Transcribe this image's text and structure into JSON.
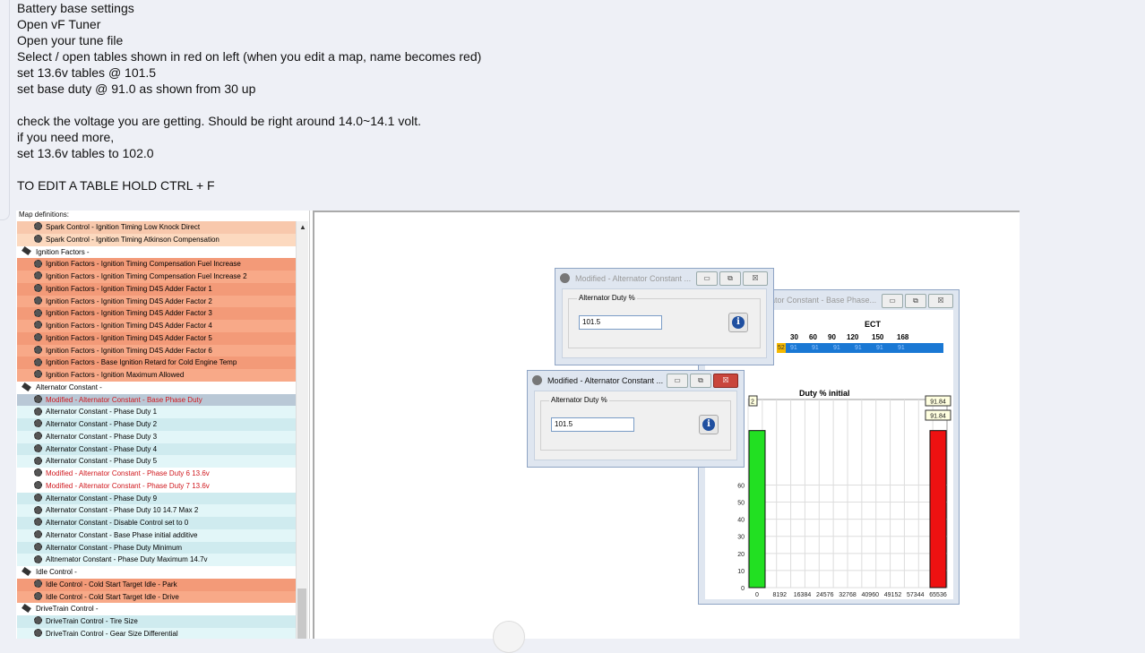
{
  "post": {
    "lines": [
      "Battery base settings",
      "Open vF Tuner",
      "Open your tune file",
      "Select / open tables shown in red on left (when you edit a map, name becomes red)",
      "set 13.6v tables @ 101.5",
      "set base duty @ 91.0 as shown from 30 up",
      "",
      "check the voltage you are getting. Should be right around 14.0~14.1 volt.",
      "if you need more,",
      "set 13.6v tables to 102.0",
      "",
      "TO EDIT A TABLE HOLD CTRL + F"
    ]
  },
  "map_panel": {
    "label": "Map definitions:",
    "rows": [
      {
        "kind": "item",
        "text": "Spark Control - Ignition Timing Low Knock Direct",
        "bg": "#f8c8ac",
        "red": false
      },
      {
        "kind": "item",
        "text": "Spark Control - Ignition Timing Atkinson Compensation",
        "bg": "#fcd9bf",
        "red": false
      },
      {
        "kind": "cat",
        "text": "Ignition Factors -",
        "bg": "#ffffff",
        "red": false
      },
      {
        "kind": "item",
        "text": "Ignition Factors - Ignition Timing Compensation Fuel Increase",
        "bg": "#f39a78",
        "red": false
      },
      {
        "kind": "item",
        "text": "Ignition Factors - Ignition Timing Compensation Fuel Increase 2",
        "bg": "#f8a988",
        "red": false
      },
      {
        "kind": "item",
        "text": "Ignition Factors - Ignition Timing D4S Adder Factor 1",
        "bg": "#f39a78",
        "red": false
      },
      {
        "kind": "item",
        "text": "Ignition Factors - Ignition Timing D4S Adder Factor 2",
        "bg": "#f8a988",
        "red": false
      },
      {
        "kind": "item",
        "text": "Ignition Factors - Ignition Timing D4S Adder Factor 3",
        "bg": "#f39a78",
        "red": false
      },
      {
        "kind": "item",
        "text": "Ignition Factors - Ignition Timing D4S Adder Factor 4",
        "bg": "#f8a988",
        "red": false
      },
      {
        "kind": "item",
        "text": "Ignition Factors - Ignition Timing D4S Adder Factor 5",
        "bg": "#f39a78",
        "red": false
      },
      {
        "kind": "item",
        "text": "Ignition Factors - Ignition Timing D4S Adder Factor 6",
        "bg": "#f8a988",
        "red": false
      },
      {
        "kind": "item",
        "text": "Ignition Factors - Base Ignition Retard for Cold Engine Temp",
        "bg": "#f39a78",
        "red": false
      },
      {
        "kind": "item",
        "text": "Ignition Factors - Ignition Maximum Allowed",
        "bg": "#f8a988",
        "red": false
      },
      {
        "kind": "cat",
        "text": "Alternator Constant -",
        "bg": "#ffffff",
        "red": false
      },
      {
        "kind": "item",
        "text": "Modified - Alternator Constant - Base Phase Duty",
        "bg": "#b9c8d6",
        "red": true
      },
      {
        "kind": "item",
        "text": "Alternator Constant - Phase Duty 1",
        "bg": "#e2f6f8",
        "red": false
      },
      {
        "kind": "item",
        "text": "Alternator Constant - Phase Duty 2",
        "bg": "#cfebef",
        "red": false
      },
      {
        "kind": "item",
        "text": "Alternator Constant - Phase Duty 3",
        "bg": "#e2f6f8",
        "red": false
      },
      {
        "kind": "item",
        "text": "Alternator Constant - Phase Duty 4",
        "bg": "#cfebef",
        "red": false
      },
      {
        "kind": "item",
        "text": "Alternator Constant - Phase Duty 5",
        "bg": "#e2f6f8",
        "red": false
      },
      {
        "kind": "item",
        "text": "Modified - Alternator Constant - Phase Duty 6 13.6v",
        "bg": "#ffffff",
        "red": true
      },
      {
        "kind": "item",
        "text": "Modified - Alternator Constant - Phase Duty 7 13.6v",
        "bg": "#ffffff",
        "red": true
      },
      {
        "kind": "item",
        "text": "Alternator Constant - Phase Duty 9",
        "bg": "#cfebef",
        "red": false
      },
      {
        "kind": "item",
        "text": "Alternator Constant - Phase Duty 10 14.7 Max 2",
        "bg": "#e2f6f8",
        "red": false
      },
      {
        "kind": "item",
        "text": "Alternator Constant - Disable Control set to 0",
        "bg": "#cfebef",
        "red": false
      },
      {
        "kind": "item",
        "text": "Alternator Constant - Base Phase initial additive",
        "bg": "#e2f6f8",
        "red": false
      },
      {
        "kind": "item",
        "text": "Alternator Constant - Phase Duty Minimum",
        "bg": "#cfebef",
        "red": false
      },
      {
        "kind": "item",
        "text": "Altnernator Constant - Phase Duty Maximum 14.7v",
        "bg": "#e2f6f8",
        "red": false
      },
      {
        "kind": "cat",
        "text": "Idle Control -",
        "bg": "#ffffff",
        "red": false
      },
      {
        "kind": "item",
        "text": "Idle Control - Cold Start Target Idle - Park",
        "bg": "#f39a78",
        "red": false
      },
      {
        "kind": "item",
        "text": "Idle Control - Cold Start Target Idle - Drive",
        "bg": "#f8a988",
        "red": false
      },
      {
        "kind": "cat",
        "text": "DriveTrain Control -",
        "bg": "#ffffff",
        "red": false
      },
      {
        "kind": "item",
        "text": "DriveTrain Control - Tire Size",
        "bg": "#cfebef",
        "red": false
      },
      {
        "kind": "item",
        "text": "DriveTrain Control - Gear Size Differential",
        "bg": "#e2f6f8",
        "red": false
      }
    ]
  },
  "dialog_back": {
    "title": "Modified - Alternator Constant ...",
    "group_label": "Alternator Duty %",
    "value": "101.5",
    "buttons": [
      "▭",
      "⧉",
      "☒"
    ]
  },
  "dialog_front": {
    "title": "Modified - Alternator Constant ...",
    "group_label": "Alternator Duty %",
    "value": "101.5",
    "buttons": [
      "▭",
      "⧉",
      "☒"
    ]
  },
  "table_window": {
    "title": "ator Constant - Base Phase...",
    "ect_label": "ECT",
    "columns": [
      "30",
      "60",
      "90",
      "120",
      "150",
      "168"
    ],
    "row_values": [
      "52",
      "91",
      "91",
      "91",
      "91",
      "91",
      "91"
    ],
    "chart_title": "Duty % initial",
    "colors": {
      "row_bg": "#1a78d4",
      "bar_low": "#22e022",
      "bar_high": "#ee1111"
    }
  },
  "chart_data": {
    "type": "bar",
    "title": "Duty % initial",
    "x_ticks": [
      "0",
      "8192",
      "16384",
      "24576",
      "32768",
      "40960",
      "49152",
      "57344",
      "65536"
    ],
    "y_ticks": [
      0,
      10,
      20,
      30,
      40,
      50,
      60
    ],
    "bars": [
      {
        "x": "0",
        "value": 91.84,
        "color": "#22e022"
      },
      {
        "x": "65536",
        "value": 91.84,
        "color": "#ee1111"
      }
    ],
    "data_labels": [
      "91.84",
      "91.84"
    ],
    "partial_label": "2"
  }
}
